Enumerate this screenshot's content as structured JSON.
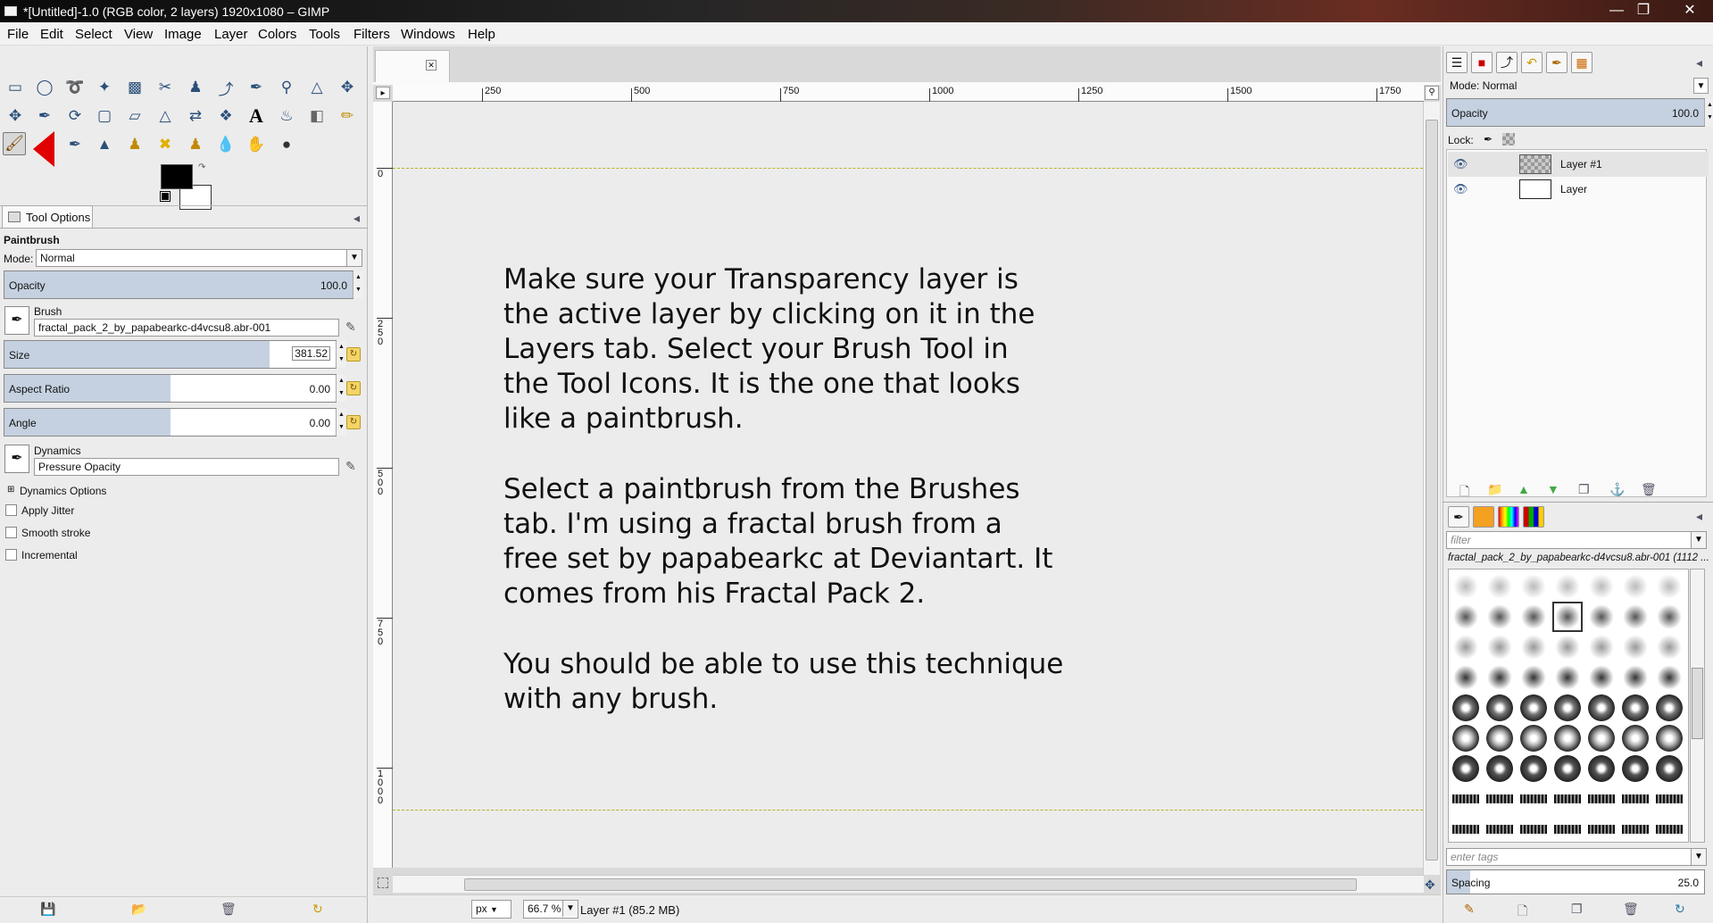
{
  "window": {
    "title": "*[Untitled]-1.0 (RGB color, 2 layers) 1920x1080 – GIMP",
    "minimize_icon": "minimize-icon",
    "maximize_icon": "maximize-icon",
    "close_icon": "close-icon"
  },
  "menu": [
    {
      "label": "File"
    },
    {
      "label": "Edit"
    },
    {
      "label": "Select"
    },
    {
      "label": "View"
    },
    {
      "label": "Image"
    },
    {
      "label": "Layer"
    },
    {
      "label": "Colors"
    },
    {
      "label": "Tools"
    },
    {
      "label": "Filters"
    },
    {
      "label": "Windows"
    },
    {
      "label": "Help"
    }
  ],
  "toolbox": {
    "tools": [
      "rect-select-icon",
      "ellipse-select-icon",
      "free-select-icon",
      "fuzzy-select-icon",
      "color-select-icon",
      "scissors-icon",
      "foreground-select-icon",
      "paths-icon",
      "color-picker-icon",
      "zoom-icon",
      "measure-icon",
      "move-icon",
      "align-icon",
      "crop-icon",
      "rotate-icon",
      "scale-icon",
      "shear-icon",
      "perspective-icon",
      "flip-icon",
      "cage-icon",
      "text-icon",
      "bucket-fill-icon",
      "blend-icon",
      "pencil-icon",
      "paintbrush-icon",
      "eraser-icon",
      "airbrush-icon",
      "ink-icon",
      "clone-icon",
      "heal-icon",
      "perspective-clone-icon",
      "blur-icon",
      "smudge-icon",
      "dodge-burn-icon"
    ],
    "selected_tool": "paintbrush-icon",
    "fg_color": "#000000",
    "bg_color": "#ffffff"
  },
  "tool_options": {
    "tab_label": "Tool Options",
    "tool_name": "Paintbrush",
    "mode_label": "Mode:",
    "mode_value": "Normal",
    "opacity_label": "Opacity",
    "opacity_value": "100.0",
    "brush_label": "Brush",
    "brush_value": "fractal_pack_2_by_papabearkc-d4vcsu8.abr-001",
    "size_label": "Size",
    "size_value": "381.52",
    "size_fraction": 0.8,
    "aspect_label": "Aspect Ratio",
    "aspect_value": "0.00",
    "aspect_fraction": 0.5,
    "angle_label": "Angle",
    "angle_value": "0.00",
    "angle_fraction": 0.5,
    "dynamics_label": "Dynamics",
    "dynamics_value": "Pressure Opacity",
    "dynamics_options_label": "Dynamics Options",
    "apply_jitter_label": "Apply Jitter",
    "smooth_stroke_label": "Smooth stroke",
    "incremental_label": "Incremental"
  },
  "canvas": {
    "ruler_h_labels": [
      "250",
      "500",
      "750",
      "1000",
      "1250",
      "1500",
      "1750"
    ],
    "ruler_v_labels": [
      "0",
      "250",
      "500",
      "750",
      "1000"
    ],
    "paragraphs": [
      "Make sure your Transparency layer is\nthe active layer by clicking on it in the\nLayers tab.  Select your Brush Tool in\nthe Tool Icons.  It is the one that looks\nlike a paintbrush.",
      "Select a paintbrush from the Brushes\ntab.  I'm using a fractal brush from a\nfree set by papabearkc at Deviantart.  It\ncomes from his Fractal Pack 2.",
      "You should be able to use this technique\nwith any brush."
    ]
  },
  "statusbar": {
    "unit": "px",
    "zoom": "66.7 %",
    "layer_info": "Layer #1 (85.2 MB)"
  },
  "layers_panel": {
    "mode_label": "Mode: Normal",
    "opacity_label": "Opacity",
    "opacity_value": "100.0",
    "lock_label": "Lock:",
    "layers": [
      {
        "name": "Layer #1",
        "visible": true,
        "transparent": true
      },
      {
        "name": "Layer",
        "visible": true,
        "transparent": false
      }
    ]
  },
  "brushes_panel": {
    "filter_placeholder": "filter",
    "brush_name": "fractal_pack_2_by_papabearkc-d4vcsu8.abr-001 (1112 ...",
    "tags_placeholder": "enter tags",
    "spacing_label": "Spacing",
    "spacing_value": "25.0"
  }
}
